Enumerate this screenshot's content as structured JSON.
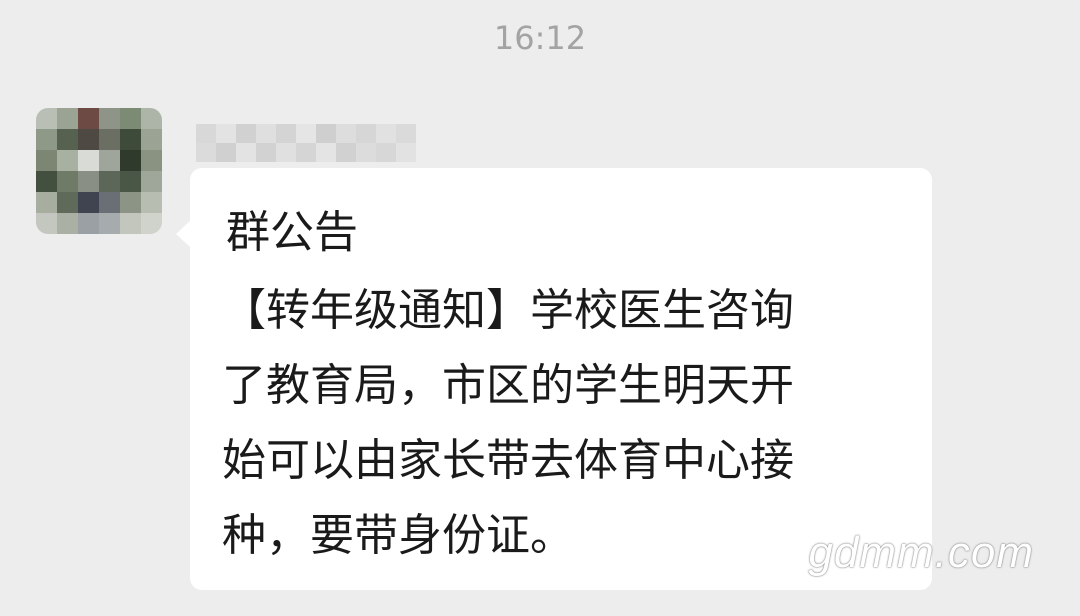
{
  "chat": {
    "timestamp": "16:12",
    "sender": {
      "avatar_icon": "avatar-icon",
      "name_pixelated": true,
      "avatar_pixels": [
        "#b9bfb4",
        "#9aa394",
        "#6e4a44",
        "#8f9489",
        "#7c8b74",
        "#adb5a8",
        "#8e9987",
        "#566150",
        "#4e4a43",
        "#6b6f63",
        "#3e4a3a",
        "#9aa394",
        "#7d8673",
        "#a8b0a2",
        "#d8dbd6",
        "#9fa59a",
        "#2f3a2d",
        "#8a9382",
        "#43503f",
        "#6f7a67",
        "#8a8f86",
        "#5c6659",
        "#4a5646",
        "#9ea799",
        "#a7ad9f",
        "#5f6a5b",
        "#3f4450",
        "#6a6f76",
        "#8c9486",
        "#b7bdb1",
        "#c3c7bf",
        "#aab1a4",
        "#9aa0a4",
        "#a6acad",
        "#c2c6bd",
        "#cfd3cb"
      ],
      "name_pixels": [
        "#d6d6d6",
        "#e3e3e3",
        "#cfcfcf",
        "#dedede",
        "#d2d2d2",
        "#e5e5e5",
        "#cccccc",
        "#dcdcdc",
        "#d4d4d4",
        "#e0e0e0",
        "#d8d8d8",
        "#dadada",
        "#cdcdcd",
        "#e2e2e2",
        "#d0d0d0",
        "#dfdfdf",
        "#d3d3d3",
        "#e4e4e4",
        "#cecece",
        "#dbdbdb",
        "#d5d5d5",
        "#e1e1e1"
      ]
    },
    "message": {
      "title": "群公告",
      "lines": [
        "【转年级通知】学校医生咨询",
        "了教育局，市区的学生明天开",
        "始可以由家长带去体育中心接",
        "种，要带身份证。"
      ]
    },
    "watermark": "gdmm.com"
  }
}
